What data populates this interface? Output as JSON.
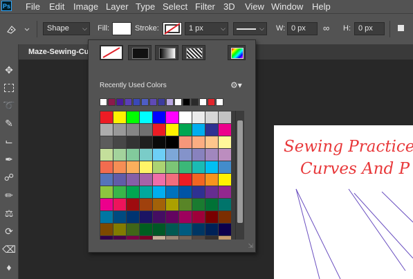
{
  "app": {
    "logo": "Ps"
  },
  "menu": [
    "File",
    "Edit",
    "Image",
    "Layer",
    "Type",
    "Select",
    "Filter",
    "3D",
    "View",
    "Window",
    "Help"
  ],
  "options_bar": {
    "mode": "Shape",
    "fill_label": "Fill:",
    "stroke_label": "Stroke:",
    "stroke_width": "1 px",
    "w_label": "W:",
    "w_value": "0 px",
    "h_label": "H:",
    "h_value": "0 px"
  },
  "document": {
    "tab_title": "Maze-Sewing-Cu"
  },
  "canvas": {
    "title_line1": "Sewing Practice",
    "title_line2": "Curves And P"
  },
  "fill_popup": {
    "recent_label": "Recently Used Colors",
    "recent_colors": [
      "#ffffff",
      "#8b1a4a",
      "#4a1c9c",
      "#5b3fb8",
      "#3a48b8",
      "#4e5dc4",
      "#5f4ab6",
      "#3c3c9e",
      "#b7a6e0",
      "#ffffff",
      "#000000",
      "#2a2a2a",
      "#ffffff",
      "#e0242c",
      "#ffffff"
    ],
    "swatches": [
      "#ed1c24",
      "#fff200",
      "#00ff00",
      "#00ffff",
      "#0000ff",
      "#ff00ff",
      "#ffffff",
      "#ebebeb",
      "#d6d6d6",
      "#c2c2c2",
      "#adadad",
      "#999999",
      "#858585",
      "#707070",
      "#ec1c24",
      "#fff100",
      "#00a651",
      "#00aeef",
      "#2e3192",
      "#ec008c",
      "#5c5c5c",
      "#474747",
      "#333333",
      "#1f1f1f",
      "#0a0a0a",
      "#000000",
      "#f7977a",
      "#fbad82",
      "#fdc68c",
      "#fff79a",
      "#c4df9b",
      "#a3d39c",
      "#82ca9c",
      "#7accc8",
      "#6dcff6",
      "#7da7d8",
      "#8493ca",
      "#8882be",
      "#a187be",
      "#bc8dbf",
      "#f26c4f",
      "#f68e55",
      "#fbaf5c",
      "#fff467",
      "#acd372",
      "#7cc576",
      "#3bb878",
      "#1abbb4",
      "#00bff3",
      "#438ccb",
      "#5574b9",
      "#605ca8",
      "#855fa8",
      "#a763a8",
      "#f06ea9",
      "#f26d7d",
      "#ed1c24",
      "#f26522",
      "#f7941d",
      "#fff200",
      "#8dc63f",
      "#39b54a",
      "#00a651",
      "#00a99d",
      "#00aeef",
      "#0072bc",
      "#0054a6",
      "#2e3192",
      "#662d91",
      "#92278f",
      "#ec008c",
      "#ed145b",
      "#9e0b0f",
      "#a0410d",
      "#a36209",
      "#aba000",
      "#598527",
      "#1a7b30",
      "#007236",
      "#00746b",
      "#0076a3",
      "#004b80",
      "#003471",
      "#1b1464",
      "#440e62",
      "#630460",
      "#9e005d",
      "#9e0039",
      "#790000",
      "#7b2e00",
      "#7d4900",
      "#827b00",
      "#406618",
      "#005e20",
      "#005826",
      "#005952",
      "#005b7f",
      "#003663",
      "#002157",
      "#0d004c",
      "#32004b",
      "#4b0049",
      "#7b0046",
      "#7a0026",
      "#c7b299",
      "#998675",
      "#736357",
      "#534741",
      "#37302d",
      "#c69c6d",
      "#a67c52",
      "#8c6239",
      "#754c24",
      "#603913",
      "#ffffff",
      "#f2f2f2",
      "#e6e6e6",
      "#cccccc",
      "#b3b3b3",
      "#999999"
    ]
  }
}
